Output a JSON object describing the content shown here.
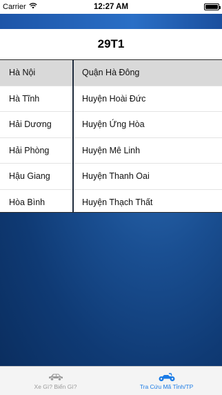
{
  "status_bar": {
    "carrier": "Carrier",
    "time": "12:27 AM"
  },
  "header": {
    "plate_code": "29T1"
  },
  "picker": {
    "provinces": [
      {
        "label": "Hà Nội",
        "selected": true
      },
      {
        "label": "Hà Tĩnh",
        "selected": false
      },
      {
        "label": "Hải Dương",
        "selected": false
      },
      {
        "label": "Hải Phòng",
        "selected": false
      },
      {
        "label": "Hậu Giang",
        "selected": false
      },
      {
        "label": "Hòa Bình",
        "selected": false
      }
    ],
    "districts": [
      {
        "label": "Quận Hà Đông",
        "selected": true
      },
      {
        "label": "Huyện Hoài Đức",
        "selected": false
      },
      {
        "label": "Huyện Ứng Hòa",
        "selected": false
      },
      {
        "label": "Huyện Mê Linh",
        "selected": false
      },
      {
        "label": "Huyện Thanh Oai",
        "selected": false
      },
      {
        "label": "Huyện Thạch Thất",
        "selected": false
      }
    ]
  },
  "tab_bar": {
    "tabs": [
      {
        "label": "Xe Gì? Biển Gì?",
        "icon": "car-icon",
        "active": false
      },
      {
        "label": "Tra Cứu Mã Tỉnh/TP",
        "icon": "motorbike-icon",
        "active": true
      }
    ],
    "colors": {
      "active": "#1a7be6",
      "inactive": "#9a9a9a"
    }
  }
}
